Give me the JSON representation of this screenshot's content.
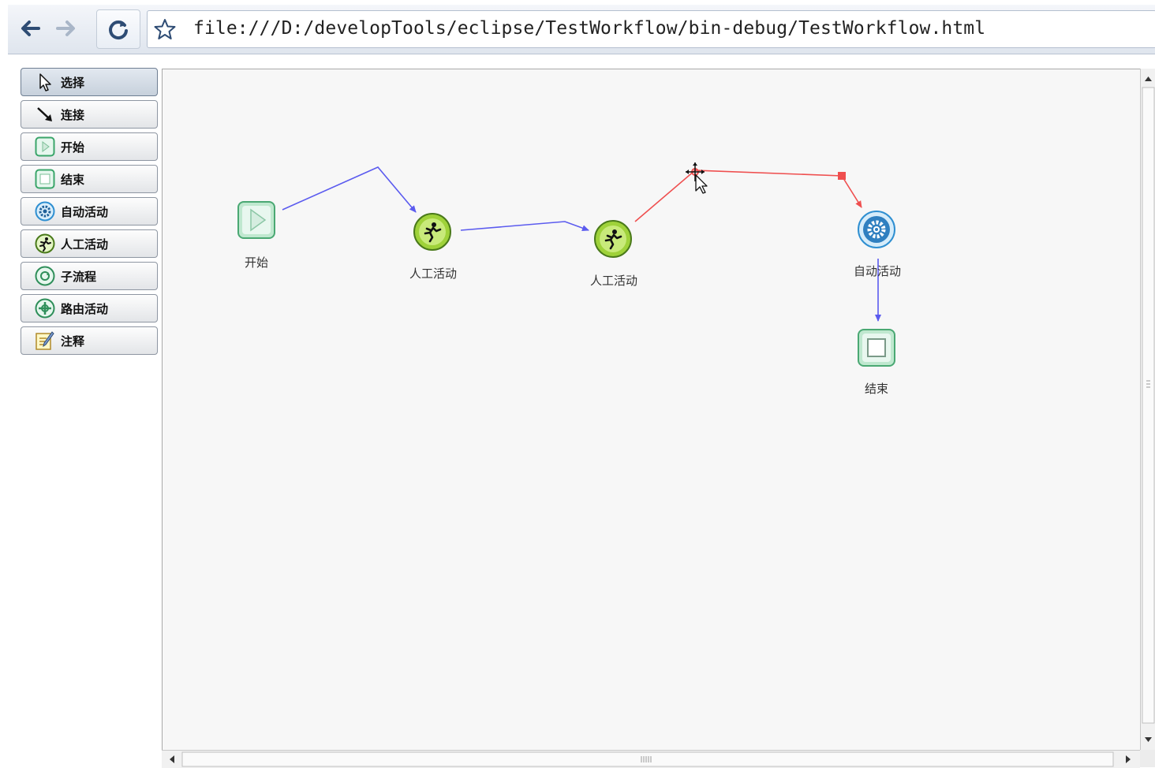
{
  "browser": {
    "url": "file:///D:/developTools/eclipse/TestWorkflow/bin-debug/TestWorkflow.html",
    "icons": {
      "back": "back-arrow-icon",
      "forward": "forward-arrow-icon",
      "reload": "reload-icon",
      "bookmark": "star-icon"
    }
  },
  "palette": {
    "items": [
      {
        "label": "选择",
        "icon": "pointer-icon",
        "selected": true
      },
      {
        "label": "连接",
        "icon": "connector-arrow-icon"
      },
      {
        "label": "开始",
        "icon": "start-node-icon"
      },
      {
        "label": "结束",
        "icon": "end-node-icon"
      },
      {
        "label": "自动活动",
        "icon": "gear-icon"
      },
      {
        "label": "人工活动",
        "icon": "running-man-icon"
      },
      {
        "label": "子流程",
        "icon": "subprocess-icon"
      },
      {
        "label": "路由活动",
        "icon": "route-icon"
      },
      {
        "label": "注释",
        "icon": "note-icon"
      }
    ]
  },
  "canvas": {
    "nodes": [
      {
        "id": "start",
        "label": "开始",
        "type": "start"
      },
      {
        "id": "manual1",
        "label": "人工活动",
        "type": "manual"
      },
      {
        "id": "manual2",
        "label": "人工活动",
        "type": "manual"
      },
      {
        "id": "auto1",
        "label": "自动活动",
        "type": "auto"
      },
      {
        "id": "end",
        "label": "结束",
        "type": "end"
      }
    ],
    "edges": [
      {
        "from": "start",
        "to": "manual1",
        "color": "#5b5bef",
        "selected": false
      },
      {
        "from": "manual1",
        "to": "manual2",
        "color": "#5b5bef",
        "selected": false
      },
      {
        "from": "manual2",
        "to": "auto1",
        "color": "#ef4f4f",
        "selected": true
      },
      {
        "from": "auto1",
        "to": "end",
        "color": "#5b5bef",
        "selected": false
      }
    ],
    "cursor": "move-cursor-icon"
  },
  "colors": {
    "edge": "#5b5bef",
    "selected_edge": "#ef4f4f",
    "manual_node": "#9fd23a",
    "start_end_node": "#bfe8cf",
    "auto_node": "#2f8fd1"
  }
}
